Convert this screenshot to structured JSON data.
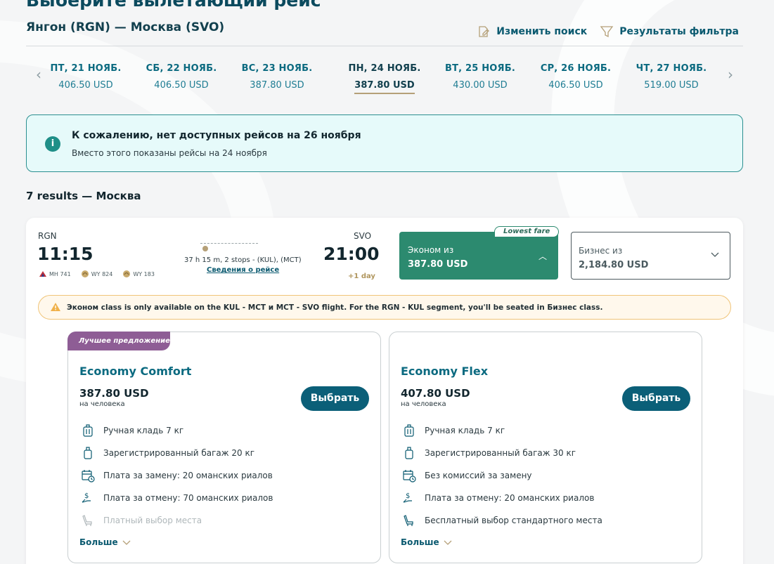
{
  "header": {
    "page_title": "Выберите вылетающий рейс",
    "route": "Янгон (RGN) — Москва (SVO)",
    "modify_search": "Изменить поиск",
    "filter_results": "Результаты фильтра"
  },
  "dates": [
    {
      "label": "ПТ, 21 НОЯБ.",
      "price": "406.50 USD"
    },
    {
      "label": "СБ, 22 НОЯБ.",
      "price": "406.50 USD"
    },
    {
      "label": "ВС, 23 НОЯБ.",
      "price": "387.80 USD"
    },
    {
      "label": "ПН, 24 НОЯБ.",
      "price": "387.80 USD",
      "active": true
    },
    {
      "label": "ВТ, 25 НОЯБ.",
      "price": "430.00 USD"
    },
    {
      "label": "СР, 26 НОЯБ.",
      "price": "406.50 USD"
    },
    {
      "label": "ЧТ, 27 НОЯБ.",
      "price": "519.00 USD"
    }
  ],
  "notice": {
    "title": "К сожалению, нет доступных рейсов на 26 ноября",
    "subtitle": "Вместо этого показаны рейсы на 24 ноября"
  },
  "results_label": "7 results — Москва",
  "flight": {
    "dep_code": "RGN",
    "dep_time": "11:15",
    "arr_code": "SVO",
    "arr_time": "21:00",
    "plus_day": "+1 day",
    "duration": "37 h 15 m, 2 stops - (KUL), (MCT)",
    "details_link": "Сведения о рейсе",
    "flights": [
      "MH 741",
      "WY 824",
      "WY 183"
    ],
    "economy_label": "Эконом из",
    "economy_price": "387.80 USD",
    "lowest_fare": "Lowest fare",
    "business_label": "Бизнес из",
    "business_price": "2,184.80 USD"
  },
  "warning": "Эконом class is only available on the KUL - MCT и MCT - SVO flight. For the RGN - KUL segment, you'll be seated in Бизнес class.",
  "fares": [
    {
      "badge": "Лучшее предложение",
      "name": "Economy Comfort",
      "price": "387.80 USD",
      "per": "на человека",
      "select": "Выбрать",
      "features": [
        {
          "icon": "carry-on-bag-icon",
          "text": "Ручная кладь 7 кг"
        },
        {
          "icon": "checked-bag-icon",
          "text": "Зарегистрированный багаж 20 кг"
        },
        {
          "icon": "calendar-change-icon",
          "text": "Плата за замену: 20 оманских риалов"
        },
        {
          "icon": "refund-icon",
          "text": "Плата за отмену: 70 оманских риалов"
        },
        {
          "icon": "seat-icon",
          "text": "Платный выбор места",
          "muted": true
        }
      ],
      "more": "Больше"
    },
    {
      "name": "Economy Flex",
      "price": "407.80 USD",
      "per": "на человека",
      "select": "Выбрать",
      "features": [
        {
          "icon": "carry-on-bag-icon",
          "text": "Ручная кладь 7 кг"
        },
        {
          "icon": "checked-bag-icon",
          "text": "Зарегистрированный багаж 30 кг"
        },
        {
          "icon": "calendar-change-icon",
          "text": "Без комиссий за замену"
        },
        {
          "icon": "refund-icon",
          "text": "Плата за отмену: 20 оманских риалов"
        },
        {
          "icon": "seat-icon",
          "text": "Бесплатный выбор стандартного места"
        }
      ],
      "more": "Больше"
    }
  ],
  "colors": {
    "brand": "#0b5f78",
    "economy_fare": "#2c8a6f",
    "best_badge": "#8e5d95",
    "notice_bg": "#e6fafa",
    "warning_border": "#f0c478"
  }
}
